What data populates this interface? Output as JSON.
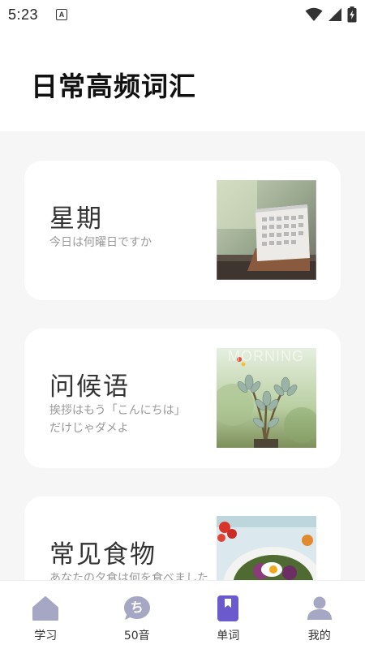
{
  "status_bar": {
    "time": "5:23",
    "notif_letter": "A"
  },
  "header": {
    "title": "日常高频词汇"
  },
  "cards": [
    {
      "title": "星期",
      "subtitle": "今日は何曜日ですか"
    },
    {
      "title": "问候语",
      "subtitle": "挨拶はもう「こんにちは」だけじゃダメよ",
      "image_text": "MORNING"
    },
    {
      "title": "常见食物",
      "subtitle": "あなたの夕食は何を食べました"
    }
  ],
  "tabs": [
    {
      "label": "学习",
      "icon": "home-icon",
      "active": false
    },
    {
      "label": "50音",
      "icon": "kana-bubble-icon",
      "badge": "ち",
      "active": false
    },
    {
      "label": "单词",
      "icon": "bookmark-book-icon",
      "active": true
    },
    {
      "label": "我的",
      "icon": "person-icon",
      "active": false
    }
  ],
  "colors": {
    "accent": "#6a5acd",
    "inactive_icon": "#a6a7c4",
    "card_bg": "#ffffff",
    "page_bg": "#f6f6f6"
  }
}
